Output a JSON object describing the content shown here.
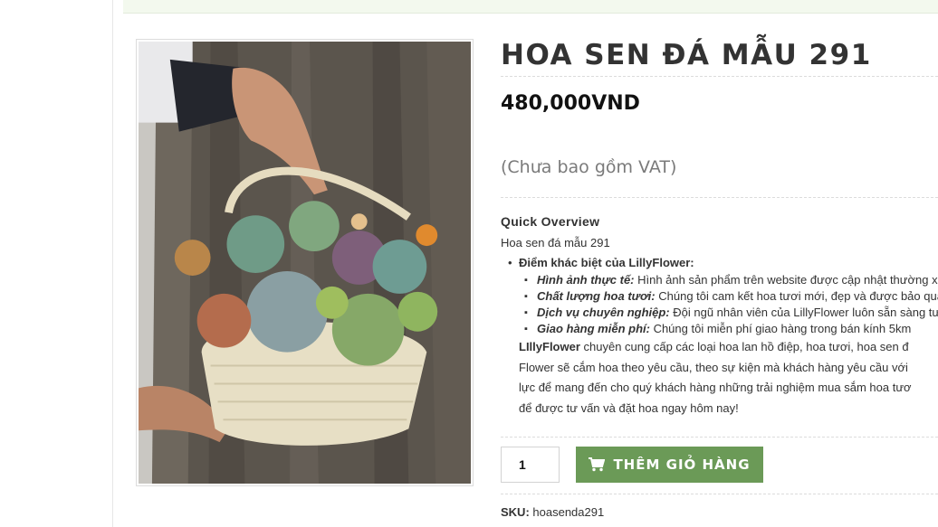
{
  "product": {
    "title": "HOA SEN ĐÁ MẪU 291",
    "price": "480,000VND",
    "vat_note": "(Chưa bao gồm VAT)",
    "overview_heading": "Quick Overview",
    "description": "Hoa sen đá mẫu 291",
    "differences_heading": "Điểm khác biệt của LillyFlower:",
    "features": [
      {
        "label": "Hình ảnh thực tế:",
        "text": " Hình ảnh sản phẩm trên website được cập nhật thường x"
      },
      {
        "label": "Chất lượng hoa tươi:",
        "text": " Chúng tôi cam kết hoa tươi mới, đẹp và được bảo quả"
      },
      {
        "label": "Dịch vụ chuyên nghiệp:",
        "text": " Đội ngũ nhân viên của LillyFlower luôn sẵn sàng tư"
      },
      {
        "label": "Giao hàng miễn phí:",
        "text": " Chúng tôi miễn phí giao hàng trong bán kính 5km"
      }
    ],
    "paragraph": {
      "brand": "LIllyFlower",
      "line1": " chuyên cung cấp các loại hoa lan hồ điệp, hoa tươi, hoa sen đ",
      "line2": "Flower sẽ cắm hoa theo yêu cầu, theo sự kiện mà khách hàng yêu cầu với",
      "line3": "lực để mang đến cho quý khách hàng những trải nghiệm mua sắm hoa tươ",
      "line4": "để được tư vấn và đặt hoa ngay hôm nay!"
    },
    "sku_label": "SKU:",
    "sku_value": "hoasenda291"
  },
  "cart": {
    "quantity": "1",
    "button_label": "THÊM GIỎ HÀNG",
    "icon": "shopping-cart-icon"
  },
  "image": {
    "subject": "succulent basket photo"
  },
  "colors": {
    "accent": "#6b9a57",
    "banner": "#f3f9ee"
  }
}
